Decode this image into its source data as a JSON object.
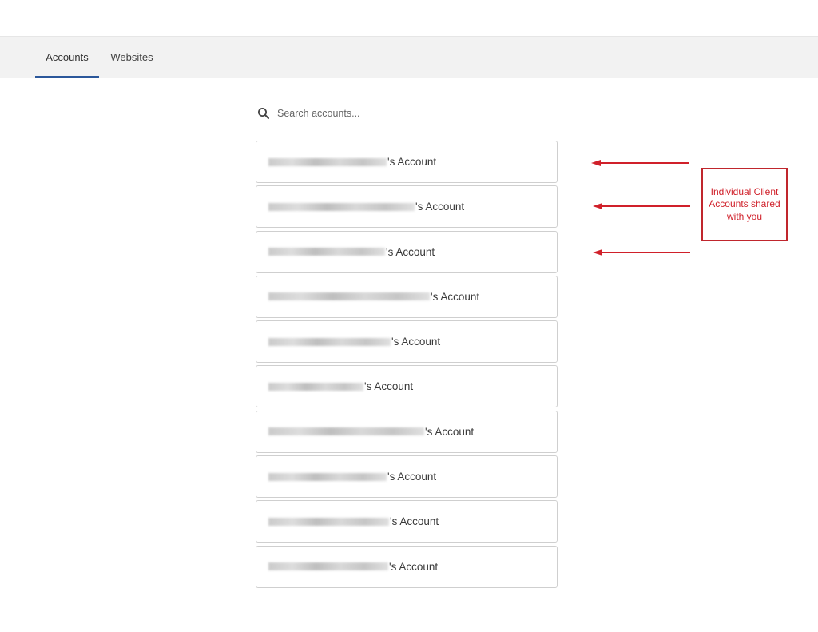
{
  "tabs": [
    {
      "label": "Accounts",
      "active": true
    },
    {
      "label": "Websites",
      "active": false
    }
  ],
  "accent_color": "#2b579a",
  "search": {
    "placeholder": "Search accounts...",
    "value": "",
    "icon": "search-icon"
  },
  "accounts": {
    "suffix": "'s Account",
    "items": [
      {
        "owner": "[redacted email]",
        "label": "[redacted]'s Account"
      },
      {
        "owner": "[redacted email]",
        "label": "[redacted]'s Account"
      },
      {
        "owner": "[redacted email]",
        "label": "[redacted]'s Account"
      },
      {
        "owner": "[redacted email]",
        "label": "[redacted]'s Account"
      },
      {
        "owner": "[redacted email]",
        "label": "[redacted]'s Account"
      },
      {
        "owner": "[redacted email]",
        "label": "[redacted]'s Account"
      },
      {
        "owner": "[redacted email]",
        "label": "[redacted]'s Account"
      },
      {
        "owner": "[redacted email]",
        "label": "[redacted]'s Account"
      },
      {
        "owner": "[redacted email]",
        "label": "[redacted]'s Account"
      },
      {
        "owner": "[redacted email]",
        "label": "[redacted]'s Account"
      }
    ]
  },
  "annotation": {
    "text": "Individual Client Accounts shared with you",
    "color": "#d0202a",
    "arrow_count": 3
  }
}
